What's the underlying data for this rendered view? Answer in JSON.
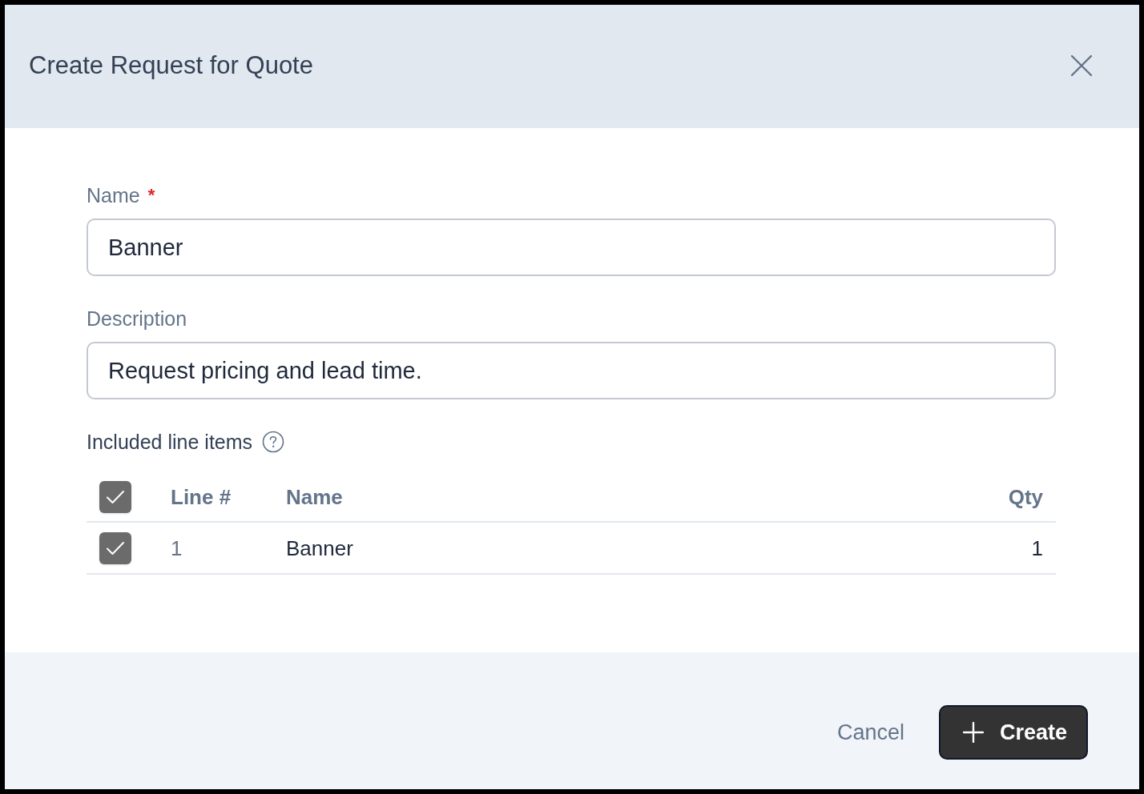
{
  "dialog": {
    "title": "Create Request for Quote"
  },
  "fields": [
    {
      "label": "Name",
      "required_mark": "*",
      "value": "Banner"
    },
    {
      "label": "Description",
      "value": "Request pricing and lead time."
    }
  ],
  "line_items": {
    "label": "Included line items",
    "columns": [
      "Line #",
      "Name",
      "Qty"
    ],
    "select_all_checked": true,
    "rows": [
      {
        "checked": true,
        "line": "1",
        "name": "Banner",
        "qty": "1"
      }
    ]
  },
  "buttons": [
    {
      "kind": "secondary",
      "label": "Cancel"
    },
    {
      "kind": "primary",
      "label": "Create"
    }
  ]
}
